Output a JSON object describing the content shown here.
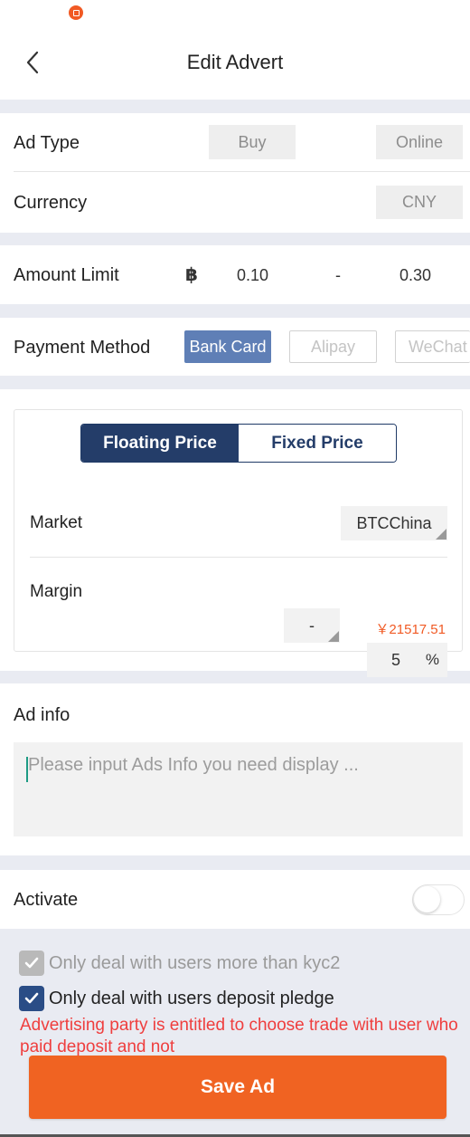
{
  "header": {
    "title": "Edit Advert"
  },
  "ad_type": {
    "label": "Ad Type",
    "value": "Buy",
    "status": "Online"
  },
  "currency": {
    "label": "Currency",
    "value": "CNY"
  },
  "amount_limit": {
    "label": "Amount Limit",
    "currency_symbol": "฿",
    "min": "0.10",
    "separator": "-",
    "max": "0.30"
  },
  "payment_method": {
    "label": "Payment Method",
    "options": [
      {
        "label": "Bank Card",
        "selected": true
      },
      {
        "label": "Alipay",
        "selected": false
      },
      {
        "label": "WeChat",
        "selected": false
      }
    ]
  },
  "pricing": {
    "tabs": [
      {
        "label": "Floating Price",
        "active": true
      },
      {
        "label": "Fixed Price",
        "active": false
      }
    ],
    "market": {
      "label": "Market",
      "value": "BTCChina"
    },
    "margin": {
      "label": "Margin",
      "sign": "-",
      "value": "5",
      "unit": "%"
    },
    "computed_price": "￥21517.51"
  },
  "ad_info": {
    "label": "Ad info",
    "placeholder": "Please input Ads Info you need display ..."
  },
  "activate": {
    "label": "Activate",
    "on": false
  },
  "options": {
    "kyc2": {
      "label": "Only deal with users more than kyc2",
      "checked": true,
      "disabled": true
    },
    "deposit": {
      "label": "Only deal with users deposit pledge",
      "checked": true,
      "disabled": false
    }
  },
  "warning": "Advertising party is entitled to choose trade with user who paid deposit and not",
  "save_button": "Save Ad",
  "colors": {
    "accent": "#f06322",
    "primary": "#243d69",
    "selected_chip": "#5f7fb6",
    "warning": "#ef3e3e",
    "price": "#f15a24"
  }
}
